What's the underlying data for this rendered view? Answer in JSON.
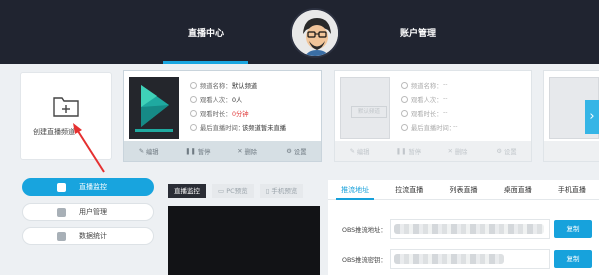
{
  "header": {
    "nav_live": "直播中心",
    "nav_account": "账户管理"
  },
  "create": {
    "label": "创建直播频道"
  },
  "channel_card": {
    "name_label": "频道名称：",
    "name_value": "默认频道",
    "viewers_label": "观看人次：",
    "viewers_value": "0人",
    "duration_label": "观看时长：",
    "duration_value": "0分钟",
    "last_live_label": "最后直播时间：",
    "last_live_value": "该频道暂未直播",
    "actions": [
      "编辑",
      "暂停",
      "删除",
      "设置"
    ]
  },
  "placeholder_card": {
    "tag": "默认频道",
    "name_label": "频道名称：",
    "name_value": "--",
    "viewers_label": "观看人次：",
    "viewers_value": "--",
    "duration_label": "观看时长：",
    "duration_value": "--",
    "last_live_label": "最后直播时间：",
    "last_live_value": "--",
    "actions": [
      "编辑",
      "暂停",
      "删除",
      "设置"
    ]
  },
  "sidebar": {
    "items": [
      {
        "label": "直播监控",
        "active": true
      },
      {
        "label": "用户管理",
        "active": false
      },
      {
        "label": "数据统计",
        "active": false
      }
    ]
  },
  "monitor_tabs": [
    "直播监控",
    "PC预览",
    "手机预览"
  ],
  "stream_tabs": [
    "推流地址",
    "拉流直播",
    "列表直播",
    "桌面直播",
    "手机直播"
  ],
  "stream_fields": {
    "address_label": "OBS推流地址：",
    "key_label": "OBS推流密钥：",
    "copy_label": "复制"
  },
  "colors": {
    "accent": "#18a4de",
    "topbar": "#202430",
    "warning": "#e03b3b"
  }
}
